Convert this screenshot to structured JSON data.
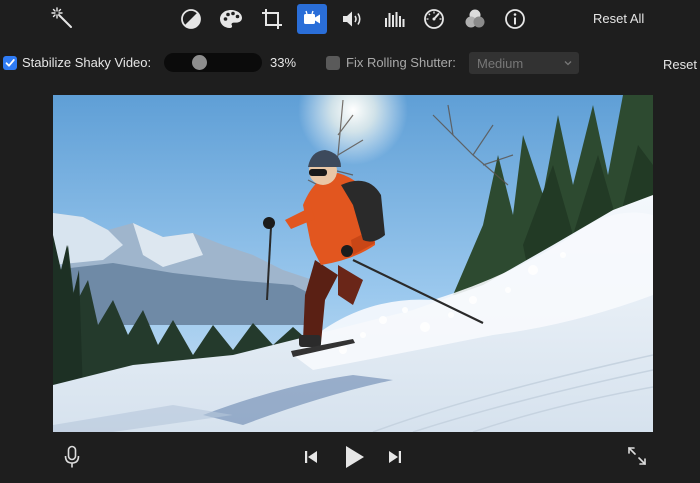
{
  "toolbar": {
    "tools": [
      {
        "name": "magic-wand-icon",
        "active": false
      },
      {
        "name": "color-balance-icon",
        "active": false
      },
      {
        "name": "color-palette-icon",
        "active": false
      },
      {
        "name": "crop-icon",
        "active": false
      },
      {
        "name": "video-camera-icon",
        "active": true
      },
      {
        "name": "volume-icon",
        "active": false
      },
      {
        "name": "equalizer-icon",
        "active": false
      },
      {
        "name": "speedometer-icon",
        "active": false
      },
      {
        "name": "filter-icon",
        "active": false
      },
      {
        "name": "info-icon",
        "active": false
      }
    ],
    "reset_all_label": "Reset All",
    "active_color": "#2a6ed8"
  },
  "options": {
    "stabilize_checked": true,
    "stabilize_label": "Stabilize Shaky Video:",
    "stabilize_percent": 33,
    "stabilize_value_text": "33%",
    "rolling_checked": false,
    "rolling_label": "Fix Rolling Shutter:",
    "rolling_select_value": "Medium",
    "reset_label": "Reset"
  },
  "viewer": {
    "content": "skier-video-frame"
  },
  "playback": {
    "buttons": [
      {
        "name": "microphone-icon"
      },
      {
        "name": "skip-back-icon"
      },
      {
        "name": "play-icon"
      },
      {
        "name": "skip-forward-icon"
      },
      {
        "name": "fullscreen-icon"
      }
    ]
  }
}
